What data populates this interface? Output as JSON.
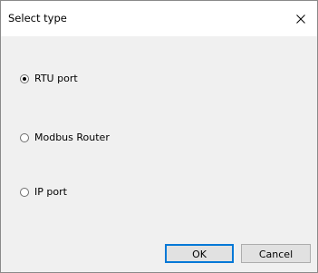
{
  "dialog": {
    "title": "Select type",
    "close_symbol": "close-icon"
  },
  "options": [
    {
      "label": "RTU port",
      "selected": true
    },
    {
      "label": "Modbus Router",
      "selected": false
    },
    {
      "label": "IP port",
      "selected": false
    }
  ],
  "buttons": {
    "ok_label": "OK",
    "cancel_label": "Cancel"
  },
  "colors": {
    "titlebar_bg": "#ffffff",
    "body_bg": "#f0f0f0",
    "button_bg": "#e1e1e1",
    "default_button_border": "#0078d7"
  }
}
